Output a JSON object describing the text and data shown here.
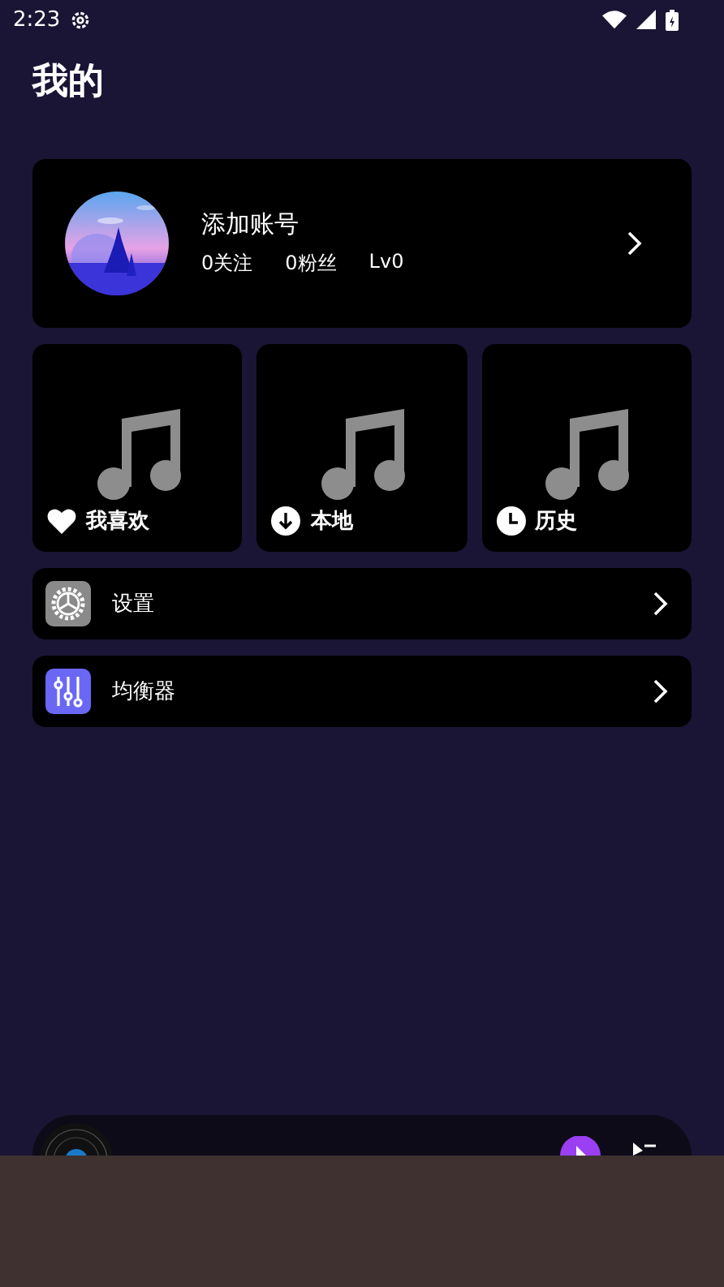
{
  "status_bar": {
    "time": "2:23"
  },
  "title": "我的",
  "account": {
    "name": "添加账号",
    "following": "0关注",
    "followers": "0粉丝",
    "level_text": "Lv0"
  },
  "tiles": [
    {
      "kind": "heart",
      "label": "我喜欢"
    },
    {
      "kind": "download",
      "label": "本地"
    },
    {
      "kind": "clock",
      "label": "历史"
    }
  ],
  "menu": [
    {
      "kind": "settings",
      "label": "设置"
    },
    {
      "kind": "equalizer",
      "label": "均衡器"
    }
  ]
}
